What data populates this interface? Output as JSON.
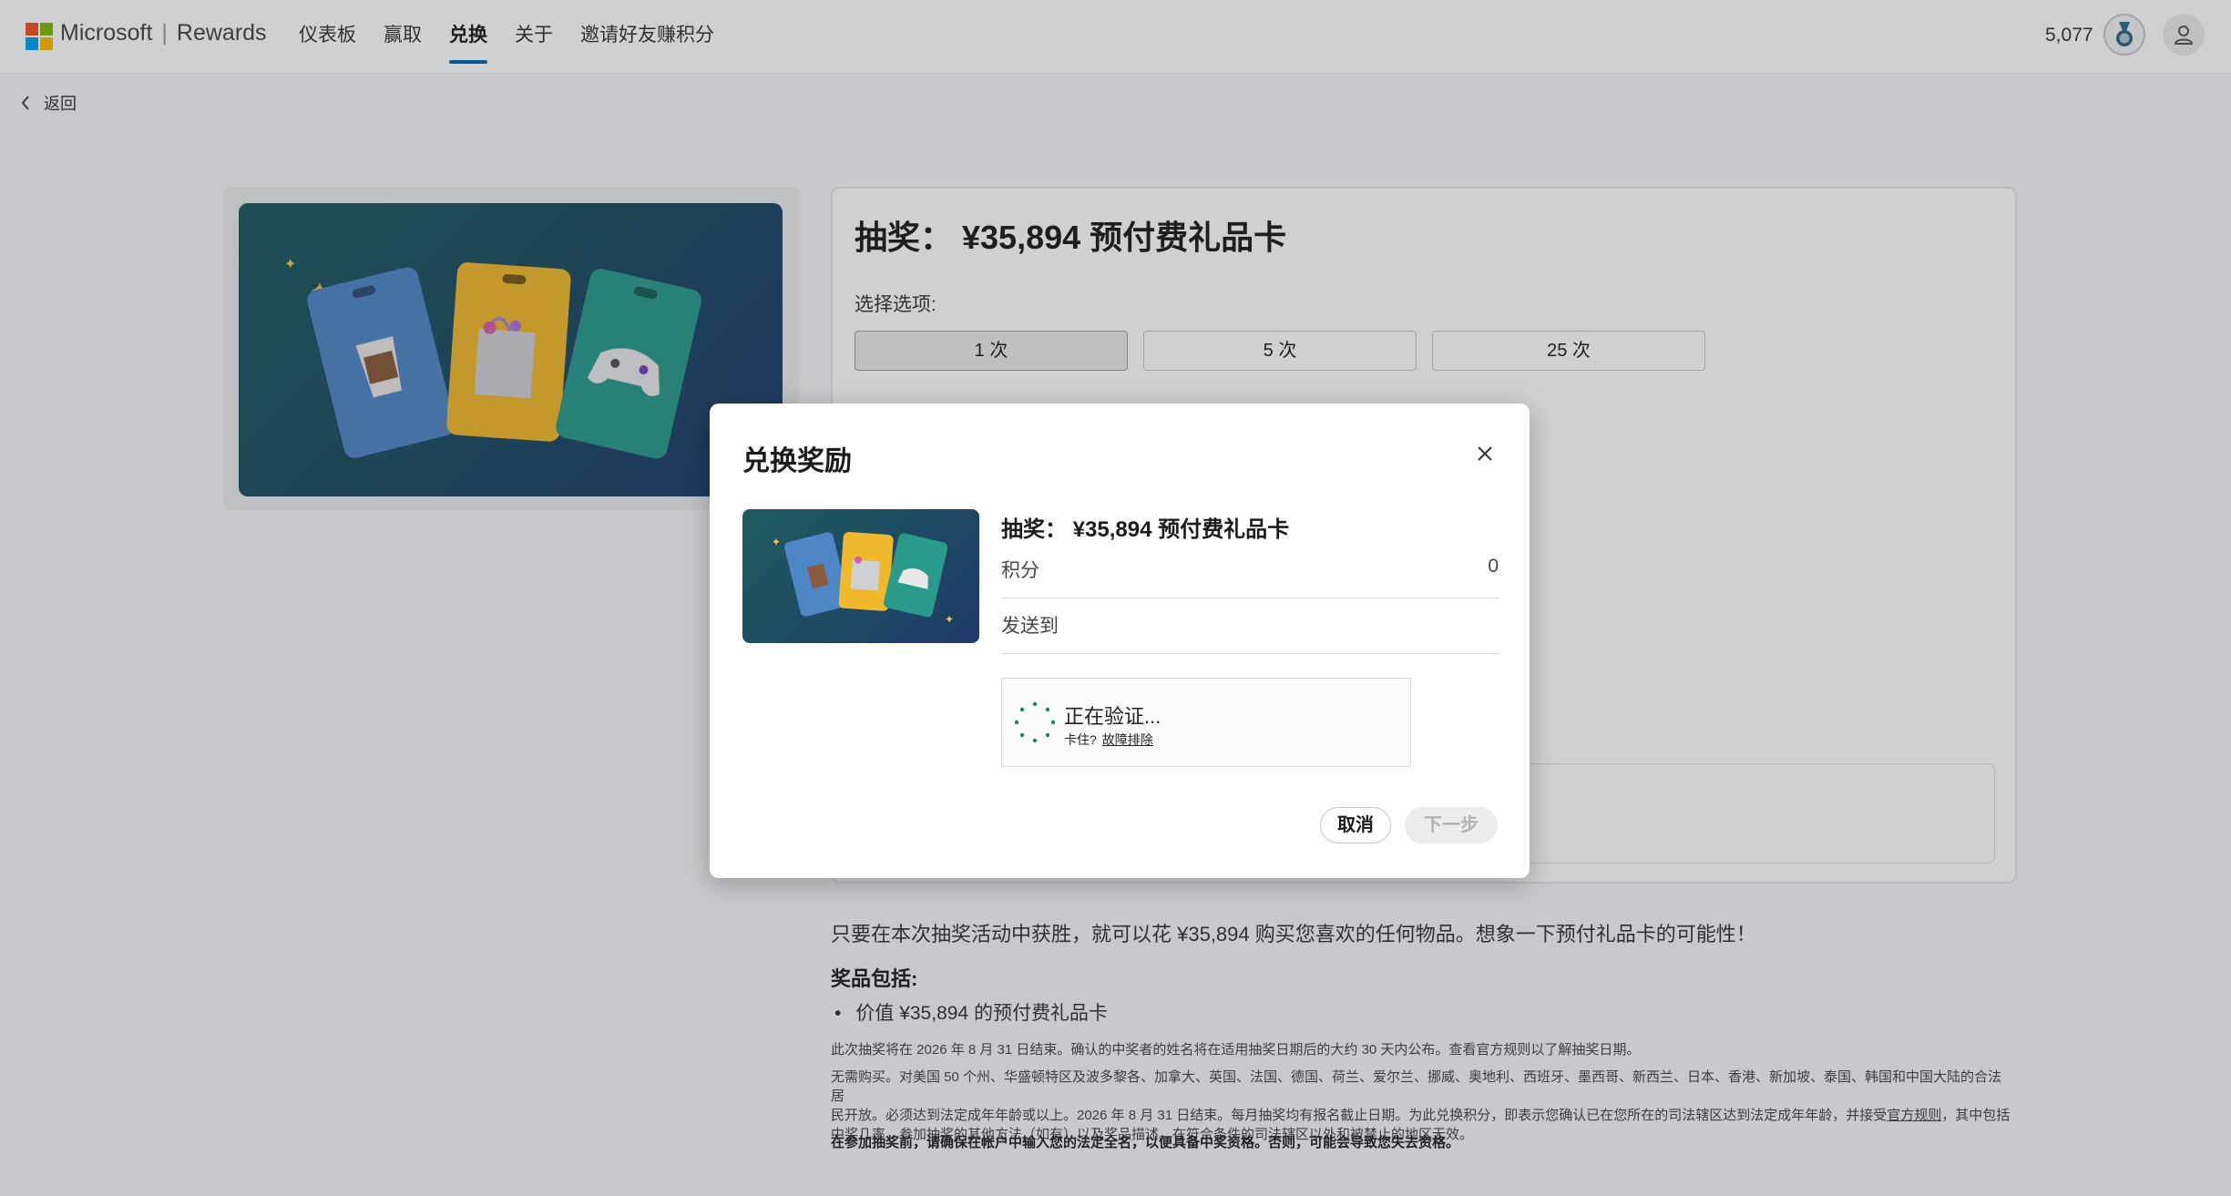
{
  "header": {
    "brand_ms": "Microsoft",
    "brand_sep": "|",
    "brand_rewards": "Rewards",
    "nav": [
      {
        "label": "仪表板"
      },
      {
        "label": "赢取"
      },
      {
        "label": "兑换",
        "active": true
      },
      {
        "label": "关于"
      },
      {
        "label": "邀请好友赚积分"
      }
    ],
    "points": "5,077",
    "logo_colors": [
      "#f25022",
      "#7fba00",
      "#00a4ef",
      "#ffb900"
    ],
    "accent_color": "#0067b8"
  },
  "back": {
    "label": "返回",
    "icon": "chevron-left-icon"
  },
  "product": {
    "title": "抽奖： ¥35,894 预付费礼品卡",
    "options_label": "选择选项:",
    "options": [
      "1 次",
      "5 次",
      "25 次"
    ],
    "selected_option": "1 次",
    "description": "只要在本次抽奖活动中获胜，就可以花 ¥35,894 购买您喜欢的任何物品。想象一下预付礼品卡的可能性！",
    "prizes_heading": "奖品包括:",
    "prize_item": "价值 ¥35,894 的预付费礼品卡",
    "fine_print_1": "此次抽奖将在 2026 年 8 月 31 日结束。确认的中奖者的姓名将在适用抽奖日期后的大约 30 天内公布。查看官方规则以了解抽奖日期。",
    "fine_print_2a": "无需购买。对美国 50 个州、华盛顿特区及波多黎各、加拿大、英国、法国、德国、荷兰、爱尔兰、挪威、奥地利、西班牙、墨西哥、新西兰、日本、香港、新加坡、泰国、韩国和中国大陆的合法居",
    "fine_print_2b": "民开放。必须达到法定成年年龄或以上。2026 年 8 月 31 日结束。每月抽奖均有报名截止日期。为此兑换积分，即表示您确认已在您所在的司法辖区达到法定成年年龄，并接受",
    "fine_print_2_link": "官方规则",
    "fine_print_2c": "，其中包括",
    "fine_print_2d": "中奖几率、参加抽奖的其他方法（如有）以及奖品描述。在符合条件的司法辖区以外和被禁止的地区无效。",
    "fine_print_3": "在参加抽奖前，请确保在帐户中输入您的法定全名，以便具备中奖资格。否则，可能会导致您失去资格。"
  },
  "modal": {
    "title": "兑换奖励",
    "product_name": "抽奖： ¥35,894 预付费礼品卡",
    "points_label": "积分",
    "points_value": "0",
    "send_to_label": "发送到",
    "verify_status": "正在验证...",
    "verify_stuck": "卡住?",
    "verify_troubleshoot": "故障排除",
    "cancel_label": "取消",
    "next_label": "下一步"
  }
}
